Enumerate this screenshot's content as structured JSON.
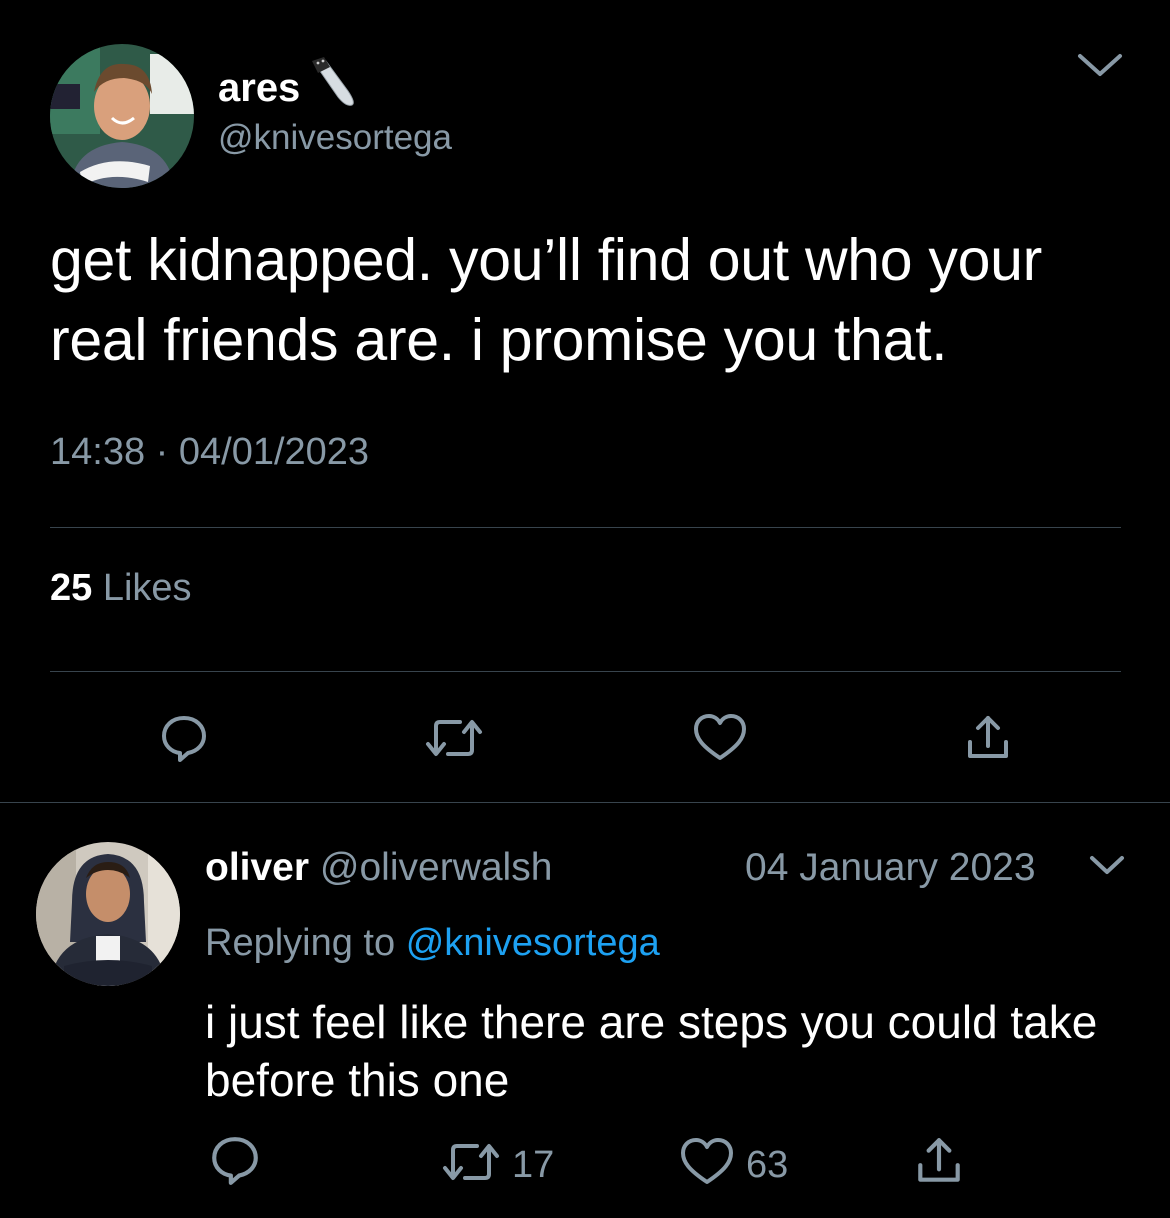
{
  "tweet": {
    "author_name": "ares",
    "author_emoji": "knife-icon",
    "author_handle": "@knivesortega",
    "text": "get kidnapped. you’ll find out who your real friends are. i promise you that.",
    "time": "14:38",
    "separator": "·",
    "date": "04/01/2023",
    "likes_count": "25",
    "likes_label": "Likes",
    "actions": [
      "reply-icon",
      "retweet-icon",
      "like-icon",
      "share-icon"
    ]
  },
  "reply": {
    "author_name": "oliver",
    "author_handle": "@oliverwalsh",
    "date": "04 January 2023",
    "replying_prefix": "Replying to",
    "replying_handle": "@knivesortega",
    "text": "i just feel like there are steps you could take before this one",
    "retweet_count": "17",
    "like_count": "63",
    "actions": [
      "reply-icon",
      "retweet-icon",
      "like-icon",
      "share-icon"
    ]
  },
  "colors": {
    "background": "#000000",
    "primary_text": "#ffffff",
    "secondary_text": "#8899a6",
    "link": "#1da1f2",
    "divider": "#38444d"
  }
}
